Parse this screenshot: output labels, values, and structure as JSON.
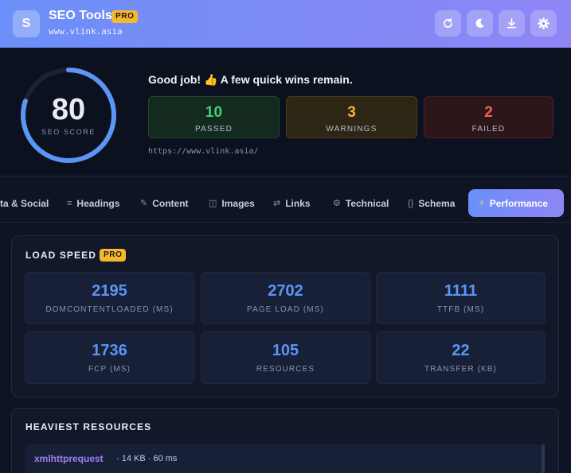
{
  "header": {
    "logo_letter": "S",
    "title": "SEO Tools",
    "badge": "PRO",
    "url": "www.vlink.asia",
    "buttons": [
      "refresh-icon",
      "moon-icon",
      "download-icon",
      "gear-icon"
    ]
  },
  "score": {
    "value": "80",
    "label": "SEO SCORE",
    "fraction": 0.8,
    "verdict": "Good job! 👍 A few quick wins remain.",
    "passed": {
      "value": "10",
      "label": "PASSED"
    },
    "warnings": {
      "value": "3",
      "label": "WARNINGS"
    },
    "failed": {
      "value": "2",
      "label": "FAILED"
    },
    "page_url": "https://www.vlink.asia/"
  },
  "tabs": [
    {
      "icon": "",
      "label": "ta & Social"
    },
    {
      "icon": "≡",
      "label": "Headings"
    },
    {
      "icon": "✎",
      "label": "Content"
    },
    {
      "icon": "◫",
      "label": "Images"
    },
    {
      "icon": "⇄",
      "label": "Links"
    },
    {
      "icon": "⚙",
      "label": "Technical"
    },
    {
      "icon": "{}",
      "label": "Schema"
    },
    {
      "icon": "⚡",
      "label": "Performance"
    }
  ],
  "load_speed": {
    "title": "LOAD SPEED",
    "badge": "PRO",
    "metrics": [
      {
        "value": "2195",
        "label": "DOMCONTENTLOADED (MS)"
      },
      {
        "value": "2702",
        "label": "PAGE LOAD (MS)"
      },
      {
        "value": "1111",
        "label": "TTFB (MS)"
      },
      {
        "value": "1736",
        "label": "FCP (MS)"
      },
      {
        "value": "105",
        "label": "RESOURCES"
      },
      {
        "value": "22",
        "label": "TRANSFER (KB)"
      }
    ]
  },
  "heaviest": {
    "title": "HEAVIEST RESOURCES",
    "items": [
      {
        "name": "xmlhttprequest",
        "meta": "· 14 KB · 60 ms"
      }
    ]
  },
  "colors": {
    "accent": "#6b8ff8",
    "passed": "#3ed26f",
    "warning": "#f5b436",
    "failed": "#f15c5c",
    "metric": "#5b95f5"
  }
}
